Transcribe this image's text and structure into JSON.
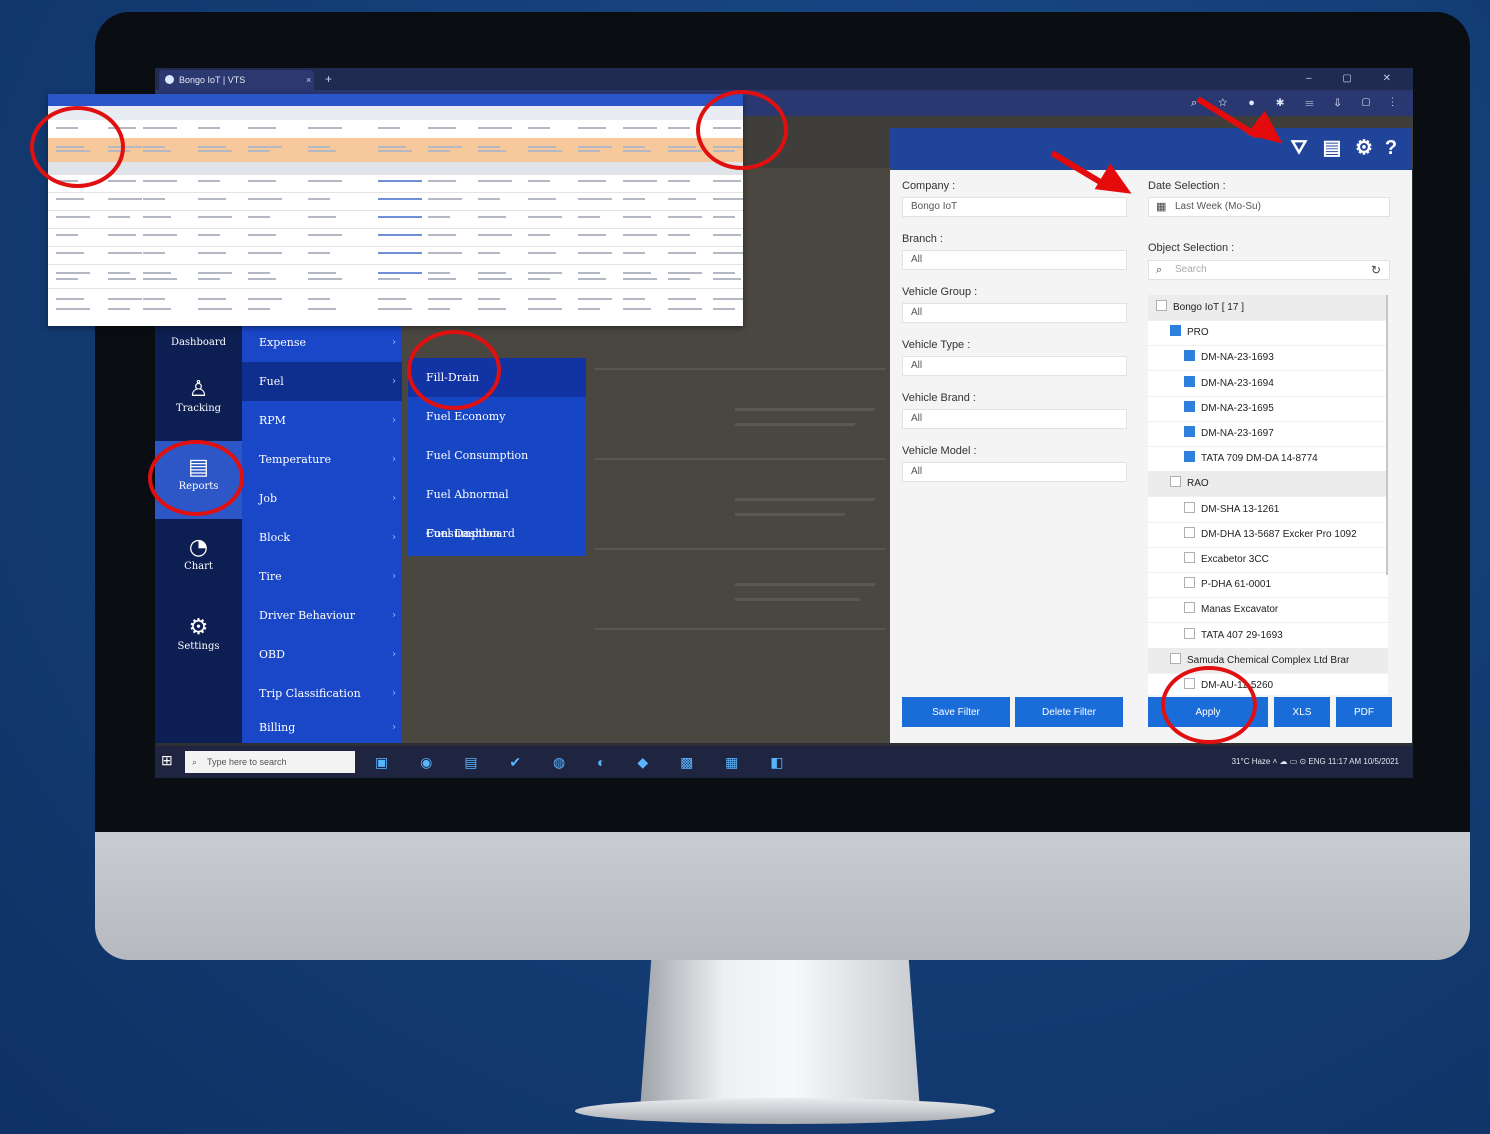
{
  "browser": {
    "tab_title": "Bongo IoT | VTS",
    "tab_close": "×",
    "new_tab": "+",
    "window_controls": "– ▢ ✕",
    "toolbar_icons": "⌕ ☆ ● ✱ ☰ ⇩ ▢ ⋮"
  },
  "header_icons": {
    "filter": "⛛",
    "export": "▤",
    "settings": "⚙",
    "help": "?"
  },
  "nav": {
    "items": [
      {
        "label": "Dashboard",
        "icon": "dashboard-icon",
        "glyph": ""
      },
      {
        "label": "Tracking",
        "icon": "tracking-icon",
        "glyph": "♙"
      },
      {
        "label": "Reports",
        "icon": "reports-icon",
        "glyph": "▤"
      },
      {
        "label": "Chart",
        "icon": "chart-icon",
        "glyph": "◔"
      },
      {
        "label": "Settings",
        "icon": "settings-icon",
        "glyph": "⚙"
      }
    ]
  },
  "reports_menu": {
    "items": [
      "Expense",
      "Fuel",
      "RPM",
      "Temperature",
      "Job",
      "Block",
      "Tire",
      "Driver Behaviour",
      "OBD",
      "Trip Classification",
      "Billing"
    ],
    "chevron": "›"
  },
  "fuel_menu": {
    "items": [
      "Fill-Drain",
      "Fuel Economy",
      "Fuel Consumption",
      "Fuel Abnormal Consumption",
      "Fuel Dashboard"
    ]
  },
  "filter": {
    "company_label": "Company :",
    "company_value": "Bongo IoT",
    "branch_label": "Branch :",
    "branch_value": "All",
    "vehicle_group_label": "Vehicle Group :",
    "vehicle_group_value": "All",
    "vehicle_type_label": "Vehicle Type :",
    "vehicle_type_value": "All",
    "vehicle_brand_label": "Vehicle Brand :",
    "vehicle_brand_value": "All",
    "vehicle_model_label": "Vehicle Model :",
    "vehicle_model_value": "All",
    "date_label": "Date Selection :",
    "date_value": "Last Week (Mo-Su)",
    "object_label": "Object Selection :",
    "search_placeholder": "Search",
    "tree": [
      {
        "label": "Bongo IoT [ 17 ]",
        "checked": false,
        "level": 0,
        "group": true
      },
      {
        "label": "PRO",
        "checked": true,
        "level": 1,
        "group": false
      },
      {
        "label": "DM-NA-23-1693",
        "checked": true,
        "level": 2,
        "group": false
      },
      {
        "label": "DM-NA-23-1694",
        "checked": true,
        "level": 2,
        "group": false
      },
      {
        "label": "DM-NA-23-1695",
        "checked": true,
        "level": 2,
        "group": false
      },
      {
        "label": "DM-NA-23-1697",
        "checked": true,
        "level": 2,
        "group": false
      },
      {
        "label": "TATA 709 DM-DA 14-8774",
        "checked": true,
        "level": 2,
        "group": false
      },
      {
        "label": "RAO",
        "checked": false,
        "level": 1,
        "group": true
      },
      {
        "label": "DM-SHA 13-1261",
        "checked": false,
        "level": 2,
        "group": false
      },
      {
        "label": "DM-DHA 13-5687 Excker Pro 1092",
        "checked": false,
        "level": 2,
        "group": false
      },
      {
        "label": "Excabetor 3CC",
        "checked": false,
        "level": 2,
        "group": false
      },
      {
        "label": "P-DHA 61-0001",
        "checked": false,
        "level": 2,
        "group": false
      },
      {
        "label": "Manas Excavator",
        "checked": false,
        "level": 2,
        "group": false
      },
      {
        "label": "TATA 407 29-1693",
        "checked": false,
        "level": 2,
        "group": false
      },
      {
        "label": "Samuda Chemical Complex Ltd Brar",
        "checked": false,
        "level": 1,
        "group": true
      },
      {
        "label": "DM-AU-11-5260",
        "checked": false,
        "level": 2,
        "group": false
      }
    ],
    "save_filter": "Save Filter",
    "delete_filter": "Delete Filter",
    "apply": "Apply",
    "xls": "XLS",
    "pdf": "PDF"
  },
  "taskbar": {
    "search_placeholder": "Type here to search",
    "tray": "31°C Haze  ˄ ☁ ▭ ⊙ ENG  11:17 AM  10/5/2021"
  },
  "colors": {
    "accent": "#1a6dd8",
    "nav_bg": "#0d1f52",
    "submenu_bg": "#1a47c7",
    "annotation": "#e01010"
  }
}
